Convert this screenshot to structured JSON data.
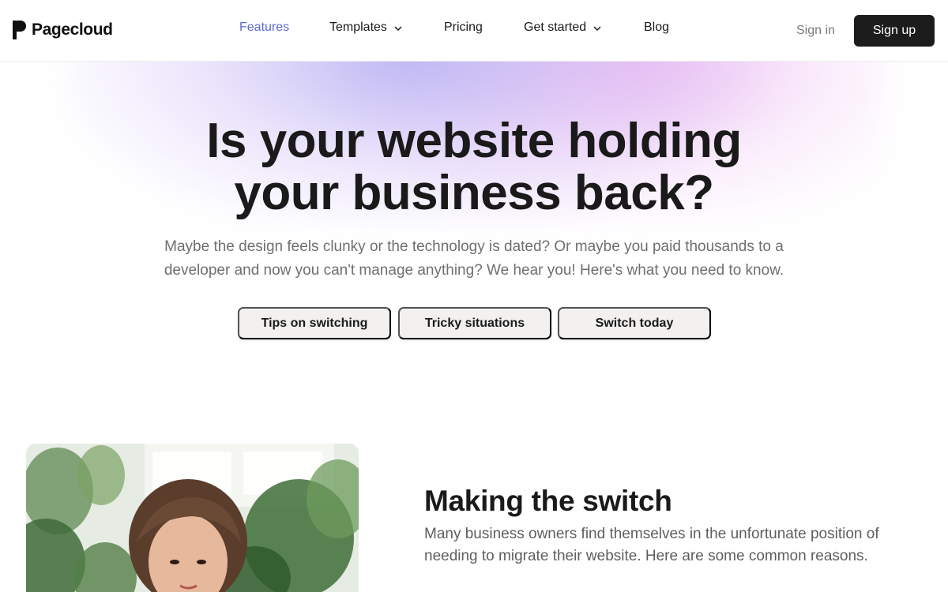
{
  "brand": {
    "name": "Pagecloud"
  },
  "nav": {
    "features": "Features",
    "templates": "Templates",
    "pricing": "Pricing",
    "get_started": "Get started",
    "blog": "Blog"
  },
  "auth": {
    "sign_in": "Sign in",
    "sign_up": "Sign up"
  },
  "hero": {
    "title_line1": "Is your website holding",
    "title_line2": "your business back?",
    "subtitle_line1": "Maybe the design feels clunky or the technology is dated? Or maybe you paid thousands to a",
    "subtitle_line2": "developer and now you can't manage anything? We hear you! Here's what you need to know.",
    "buttons": [
      "Tips on switching",
      "Tricky situations",
      "Switch today"
    ]
  },
  "section": {
    "title": "Making the switch",
    "body_line1": "Many business owners find themselves in the unfortunate position of",
    "body_line2": "needing to migrate their website. Here are some common reasons."
  },
  "colors": {
    "accent_link": "#5b6ad0",
    "primary_button": "#1c1c1c",
    "pill_bg": "#f3f1ef",
    "glow_purple": "#a8a2f0",
    "glow_pink": "#e6a0eb"
  },
  "icons": {
    "logo": "pagecloud-logo-icon",
    "dropdown": "chevron-down-icon"
  }
}
